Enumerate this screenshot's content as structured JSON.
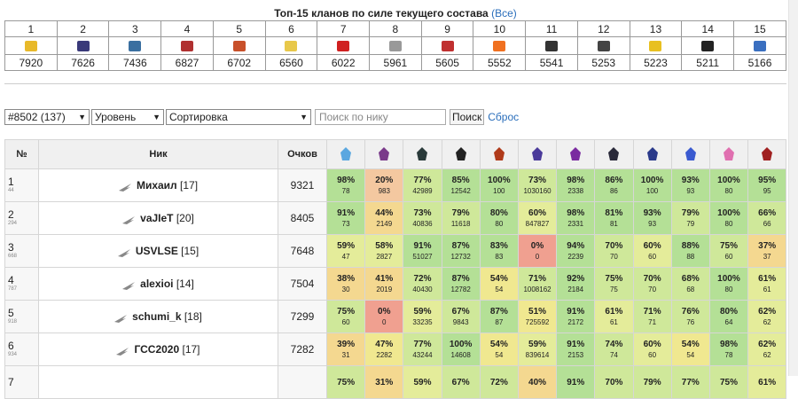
{
  "top_title": "Топ-15 кланов по силе текущего состава",
  "top_all_link": "(Все)",
  "clans": [
    {
      "rank": "1",
      "score": "7920",
      "icon": "ukraine-flag-icon",
      "color": "#e8b92a"
    },
    {
      "rank": "2",
      "score": "7626",
      "icon": "sunset-icon",
      "color": "#3a3a7a"
    },
    {
      "rank": "3",
      "score": "7436",
      "icon": "shark-icon",
      "color": "#3a6fa0"
    },
    {
      "rank": "4",
      "score": "6827",
      "icon": "crossed-swords-icon",
      "color": "#b03030"
    },
    {
      "rank": "5",
      "score": "6702",
      "icon": "shield-icon",
      "color": "#c8502a"
    },
    {
      "rank": "6",
      "score": "6560",
      "icon": "smiley-icon",
      "color": "#e8c84a"
    },
    {
      "rank": "7",
      "score": "6022",
      "icon": "red-stripe-icon",
      "color": "#d02020"
    },
    {
      "rank": "8",
      "score": "5961",
      "icon": "dm-text-icon",
      "color": "#999999"
    },
    {
      "rank": "9",
      "score": "5605",
      "icon": "burst-icon",
      "color": "#c03030"
    },
    {
      "rank": "10",
      "score": "5552",
      "icon": "lock-icon",
      "color": "#f07020"
    },
    {
      "rank": "11",
      "score": "5541",
      "icon": "skull-wings-icon",
      "color": "#333333"
    },
    {
      "rank": "12",
      "score": "5253",
      "icon": "slash-icon",
      "color": "#444444"
    },
    {
      "rank": "13",
      "score": "5223",
      "icon": "helmet-icon",
      "color": "#e8c020"
    },
    {
      "rank": "14",
      "score": "5211",
      "icon": "winged-heart-icon",
      "color": "#222222"
    },
    {
      "rank": "15",
      "score": "5166",
      "icon": "cat-icon",
      "color": "#3a6fc0"
    }
  ],
  "controls": {
    "clan_select": "#8502 (137)",
    "level_select": "Уровень",
    "sort_select": "Сортировка",
    "search_placeholder": "Поиск по нику",
    "search_button": "Поиск",
    "reset_link": "Сброс"
  },
  "table_headers": {
    "num": "№",
    "nick": "Ник",
    "score": "Очков"
  },
  "hero_columns": [
    {
      "icon": "snowflake-hero-icon",
      "color": "#5aa7e0"
    },
    {
      "icon": "hooded-hero-icon",
      "color": "#7a3a8a"
    },
    {
      "icon": "dark-beast-hero-icon",
      "color": "#2a3a3a"
    },
    {
      "icon": "shadow-hero-icon",
      "color": "#222222"
    },
    {
      "icon": "demon-face-hero-icon",
      "color": "#b03a1a"
    },
    {
      "icon": "winged-purple-hero-icon",
      "color": "#4a3a9a"
    },
    {
      "icon": "purple-star-hero-icon",
      "color": "#7a2aa0"
    },
    {
      "icon": "dark-knight-hero-icon",
      "color": "#2a2a3a"
    },
    {
      "icon": "blue-armor-hero-icon",
      "color": "#2a3a8a"
    },
    {
      "icon": "blue-dragon-hero-icon",
      "color": "#3a5ad0"
    },
    {
      "icon": "pink-flower-hero-icon",
      "color": "#e070b0"
    },
    {
      "icon": "red-demon-hero-icon",
      "color": "#a02020"
    }
  ],
  "players": [
    {
      "num": "1",
      "sub": "44",
      "nick": "Михаил",
      "level": "[17]",
      "score": "9321",
      "cells": [
        [
          "98%",
          "78"
        ],
        [
          "20%",
          "983"
        ],
        [
          "77%",
          "42989"
        ],
        [
          "85%",
          "12542"
        ],
        [
          "100%",
          "100"
        ],
        [
          "73%",
          "1030160"
        ],
        [
          "98%",
          "2338"
        ],
        [
          "86%",
          "86"
        ],
        [
          "100%",
          "100"
        ],
        [
          "93%",
          "93"
        ],
        [
          "100%",
          "80"
        ],
        [
          "95%",
          "95"
        ]
      ]
    },
    {
      "num": "2",
      "sub": "294",
      "nick": "vaJIeT",
      "level": "[20]",
      "score": "8405",
      "cells": [
        [
          "91%",
          "73"
        ],
        [
          "44%",
          "2149"
        ],
        [
          "73%",
          "40836"
        ],
        [
          "79%",
          "11618"
        ],
        [
          "80%",
          "80"
        ],
        [
          "60%",
          "847827"
        ],
        [
          "98%",
          "2331"
        ],
        [
          "81%",
          "81"
        ],
        [
          "93%",
          "93"
        ],
        [
          "79%",
          "79"
        ],
        [
          "100%",
          "80"
        ],
        [
          "66%",
          "66"
        ]
      ]
    },
    {
      "num": "3",
      "sub": "668",
      "nick": "USVLSE",
      "level": "[15]",
      "score": "7648",
      "cells": [
        [
          "59%",
          "47"
        ],
        [
          "58%",
          "2827"
        ],
        [
          "91%",
          "51027"
        ],
        [
          "87%",
          "12732"
        ],
        [
          "83%",
          "83"
        ],
        [
          "0%",
          "0"
        ],
        [
          "94%",
          "2239"
        ],
        [
          "70%",
          "70"
        ],
        [
          "60%",
          "60"
        ],
        [
          "88%",
          "88"
        ],
        [
          "75%",
          "60"
        ],
        [
          "37%",
          "37"
        ]
      ]
    },
    {
      "num": "4",
      "sub": "787",
      "nick": "alexioi",
      "level": "[14]",
      "score": "7504",
      "cells": [
        [
          "38%",
          "30"
        ],
        [
          "41%",
          "2019"
        ],
        [
          "72%",
          "40430"
        ],
        [
          "87%",
          "12782"
        ],
        [
          "54%",
          "54"
        ],
        [
          "71%",
          "1008162"
        ],
        [
          "92%",
          "2184"
        ],
        [
          "75%",
          "75"
        ],
        [
          "70%",
          "70"
        ],
        [
          "68%",
          "68"
        ],
        [
          "100%",
          "80"
        ],
        [
          "61%",
          "61"
        ]
      ]
    },
    {
      "num": "5",
      "sub": "918",
      "nick": "schumi_k",
      "level": "[18]",
      "score": "7299",
      "cells": [
        [
          "75%",
          "60"
        ],
        [
          "0%",
          "0"
        ],
        [
          "59%",
          "33235"
        ],
        [
          "67%",
          "9843"
        ],
        [
          "87%",
          "87"
        ],
        [
          "51%",
          "725592"
        ],
        [
          "91%",
          "2172"
        ],
        [
          "61%",
          "61"
        ],
        [
          "71%",
          "71"
        ],
        [
          "76%",
          "76"
        ],
        [
          "80%",
          "64"
        ],
        [
          "62%",
          "62"
        ]
      ]
    },
    {
      "num": "6",
      "sub": "934",
      "nick": "ГСС2020",
      "level": "[17]",
      "score": "7282",
      "cells": [
        [
          "39%",
          "31"
        ],
        [
          "47%",
          "2282"
        ],
        [
          "77%",
          "43244"
        ],
        [
          "100%",
          "14608"
        ],
        [
          "54%",
          "54"
        ],
        [
          "59%",
          "839614"
        ],
        [
          "91%",
          "2153"
        ],
        [
          "74%",
          "74"
        ],
        [
          "60%",
          "60"
        ],
        [
          "54%",
          "54"
        ],
        [
          "98%",
          "78"
        ],
        [
          "62%",
          "62"
        ]
      ]
    },
    {
      "num": "7",
      "sub": "",
      "nick": "",
      "level": "",
      "score": "",
      "cells": [
        [
          "75%",
          ""
        ],
        [
          "31%",
          ""
        ],
        [
          "59%",
          ""
        ],
        [
          "67%",
          ""
        ],
        [
          "72%",
          ""
        ],
        [
          "40%",
          ""
        ],
        [
          "91%",
          ""
        ],
        [
          "70%",
          ""
        ],
        [
          "79%",
          ""
        ],
        [
          "77%",
          ""
        ],
        [
          "75%",
          ""
        ],
        [
          "61%",
          ""
        ]
      ]
    }
  ]
}
